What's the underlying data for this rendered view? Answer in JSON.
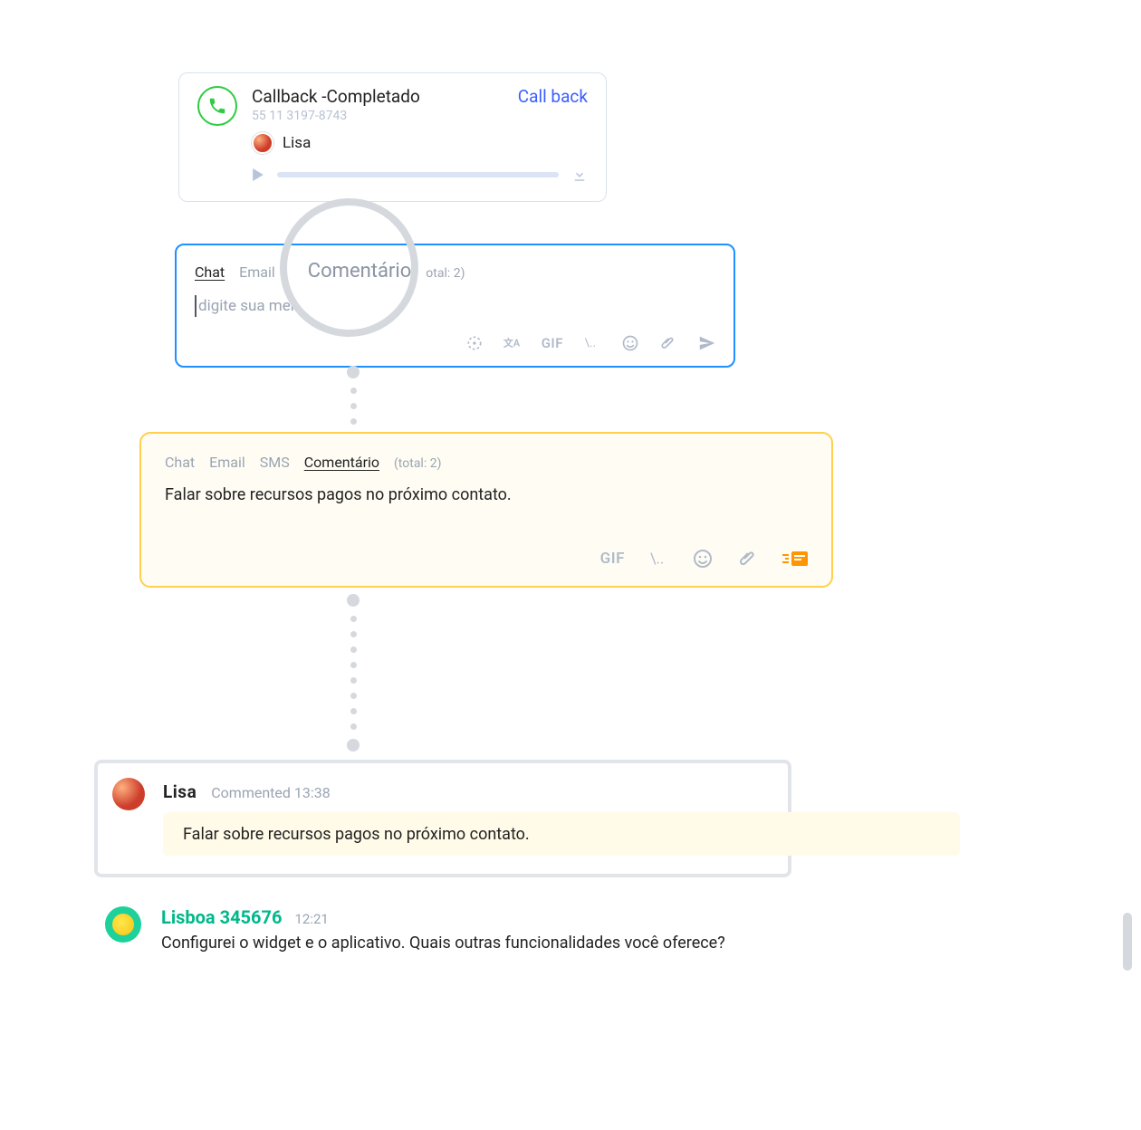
{
  "callback": {
    "title": "Callback -Completado",
    "link_label": "Call back",
    "phone": "55 11 3197-8743",
    "agent_name": "Lisa"
  },
  "compose_blue": {
    "tabs": {
      "chat": "Chat",
      "email": "Email",
      "comment": "Comentário"
    },
    "total_label": "otal: 2)",
    "placeholder": "digite sua mer"
  },
  "compose_yellow": {
    "tabs": {
      "chat": "Chat",
      "email": "Email",
      "sms": "SMS",
      "comment": "Comentário"
    },
    "total_label": "(total: 2)",
    "text": "Falar sobre recursos pagos no próximo contato."
  },
  "toolbar": {
    "gif_label": "GIF"
  },
  "comment_panel": {
    "name": "Lisa",
    "meta_label": "Commented",
    "meta_time": "13:38",
    "text": "Falar sobre recursos pagos no próximo contato."
  },
  "contact_msg": {
    "name": "Lisboa 345676",
    "time": "12:21",
    "text": "Configurei o widget e o aplicativo. Quais outras funcionalidades você oferece?"
  }
}
